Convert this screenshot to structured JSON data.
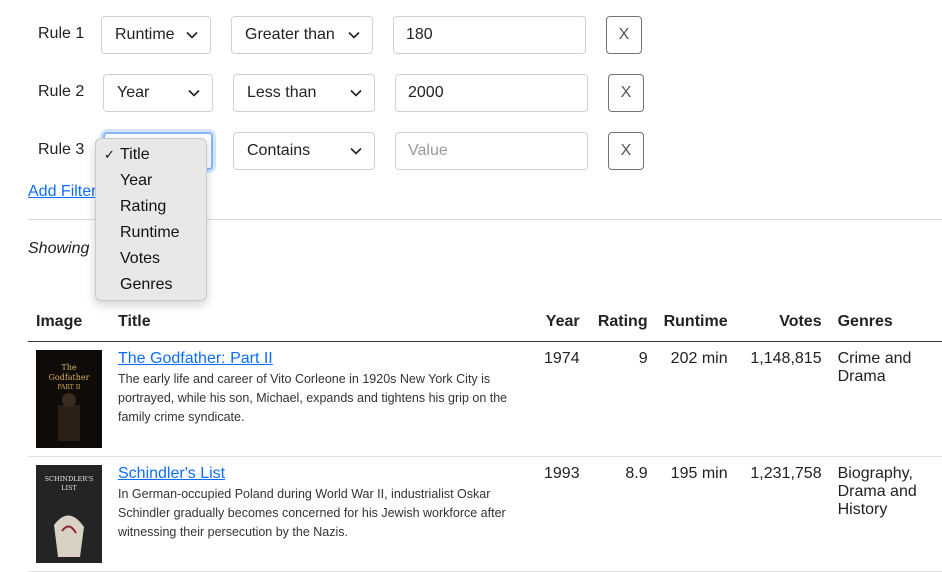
{
  "rules": [
    {
      "label": "Rule 1",
      "field": "Runtime",
      "operator": "Greater than",
      "value": "180",
      "value_placeholder": "",
      "remove": "X"
    },
    {
      "label": "Rule 2",
      "field": "Year",
      "operator": "Less than",
      "value": "2000",
      "value_placeholder": "",
      "remove": "X"
    },
    {
      "label": "Rule 3",
      "field": "Title",
      "operator": "Contains",
      "value": "",
      "value_placeholder": "Value",
      "remove": "X"
    }
  ],
  "field_dropdown": {
    "selected": "Title",
    "check": "✓",
    "options": [
      "Title",
      "Year",
      "Rating",
      "Runtime",
      "Votes",
      "Genres"
    ]
  },
  "add_filter_label": "Add Filter",
  "showing_text": "Showing",
  "table": {
    "columns": [
      "Image",
      "Title",
      "Year",
      "Rating",
      "Runtime",
      "Votes",
      "Genres"
    ],
    "rows": [
      {
        "title": "The Godfather: Part II",
        "description": "The early life and career of Vito Corleone in 1920s New York City is portrayed, while his son, Michael, expands and tightens his grip on the family crime syndicate.",
        "year": "1974",
        "rating": "9",
        "runtime": "202 min",
        "votes": "1,148,815",
        "genres": "Crime and Drama",
        "poster_text": "The Godfather PART II"
      },
      {
        "title": "Schindler's List",
        "description": "In German-occupied Poland during World War II, industrialist Oskar Schindler gradually becomes concerned for his Jewish workforce after witnessing their persecution by the Nazis.",
        "year": "1993",
        "rating": "8.9",
        "runtime": "195 min",
        "votes": "1,231,758",
        "genres": "Biography, Drama and History",
        "poster_text": "SCHINDLER'S LIST"
      }
    ]
  },
  "colors": {
    "link": "#0d6efd",
    "focus": "#86b7fe",
    "dropdown_bg": "#e8e8e8"
  },
  "icons": {
    "select_arrow": "chevron-down-icon",
    "checkmark": "check-icon"
  }
}
